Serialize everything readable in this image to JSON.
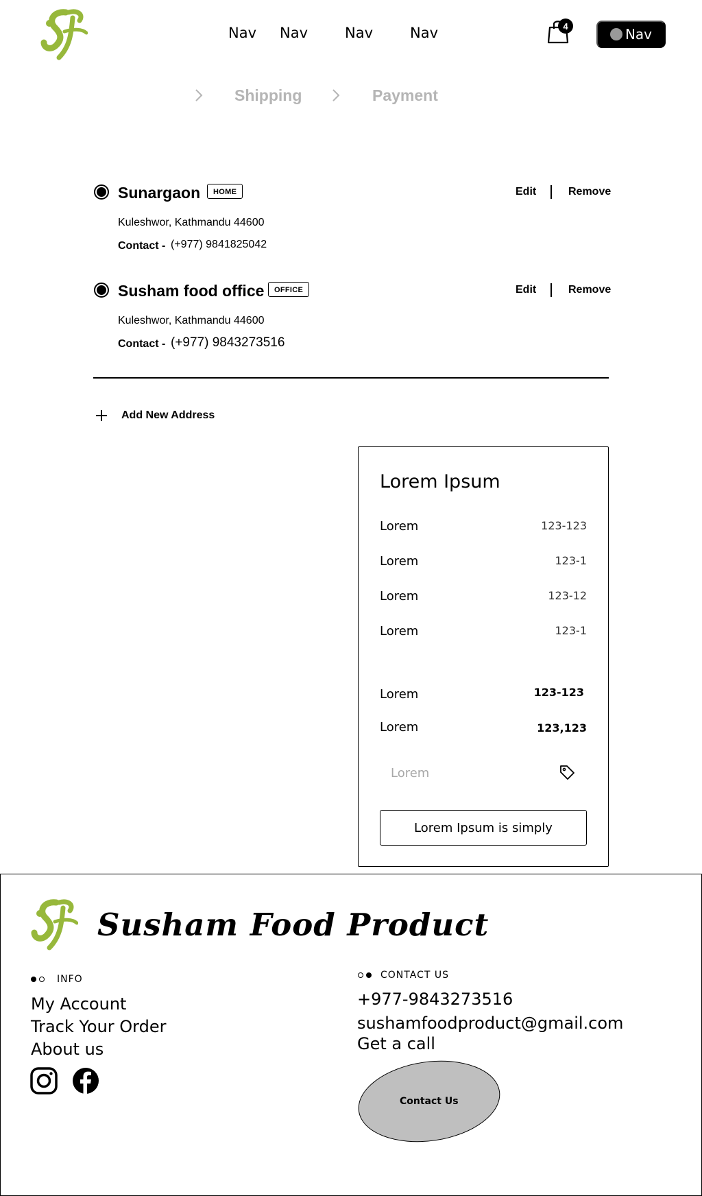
{
  "colors": {
    "brand_green": "#97b83b",
    "breadcrumb_gray": "#b5b5b5",
    "contact_button_bg": "#bfbfbf"
  },
  "header": {
    "logo_icon": "sf-leaf-logo",
    "nav": [
      "Nav",
      "Nav",
      "Nav",
      "Nav"
    ],
    "cart_icon": "shopping-bag-icon",
    "cart_count": "4",
    "account_button": "Nav"
  },
  "breadcrumb": {
    "steps": [
      "Shipping",
      "Payment"
    ],
    "separator_icon": "chevron-right-icon"
  },
  "addresses": [
    {
      "name": "Sunargaon",
      "tag": "HOME",
      "line": "Kuleshwor, Kathmandu 44600",
      "contact_label": "Contact -",
      "contact": "(+977) 9841825042",
      "edit": "Edit",
      "remove": "Remove"
    },
    {
      "name": "Susham food office",
      "tag": "OFFICE",
      "line": "Kuleshwor, Kathmandu 44600",
      "contact_label": "Contact -",
      "contact": "(+977) 9843273516",
      "edit": "Edit",
      "remove": "Remove"
    }
  ],
  "add_address": {
    "label": "Add New Address",
    "icon": "plus-icon"
  },
  "summary": {
    "title": "Lorem Ipsum",
    "rows": [
      {
        "label": "Lorem",
        "value": "123-123"
      },
      {
        "label": "Lorem",
        "value": "123-1"
      },
      {
        "label": "Lorem",
        "value": "123-12"
      },
      {
        "label": "Lorem",
        "value": "123-1"
      }
    ],
    "totals": [
      {
        "label": "Lorem",
        "value": "123-123"
      },
      {
        "label": "Lorem",
        "value": "123,123"
      }
    ],
    "promo_placeholder": "Lorem",
    "promo_icon": "price-tag-icon",
    "button": "Lorem Ipsum is simply"
  },
  "footer": {
    "brand": "Susham Food Product",
    "info_heading": "INFO",
    "info_links": [
      "My Account",
      "Track Your Order",
      "About us"
    ],
    "social_icons": [
      "instagram-icon",
      "facebook-icon"
    ],
    "contact_heading": "CONTACT US",
    "phone": "+977-9843273516",
    "email": "sushamfoodproduct@gmail.com",
    "call": "Get a call",
    "contact_button": "Contact Us"
  }
}
